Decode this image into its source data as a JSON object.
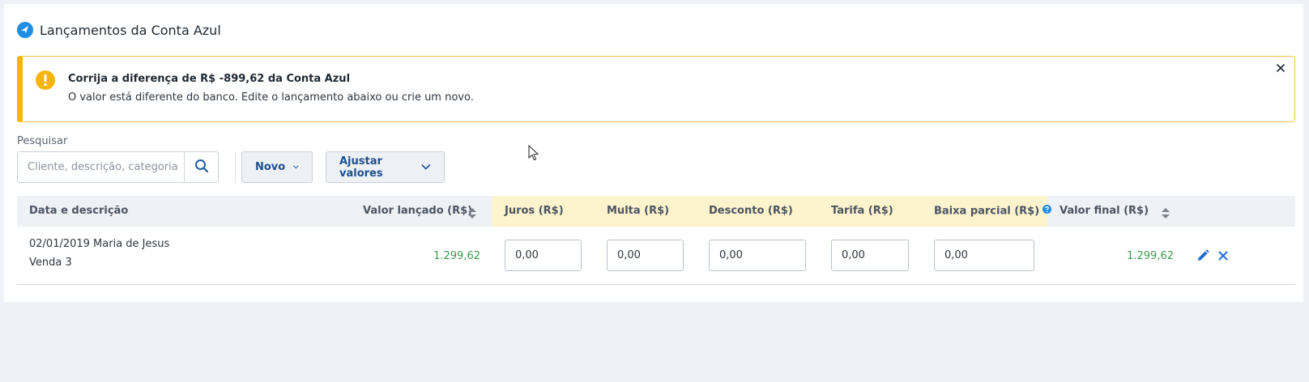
{
  "header": {
    "title": "Lançamentos da Conta Azul"
  },
  "alert": {
    "title": "Corrija a diferença de R$ -899,62 da Conta Azul",
    "message": "O valor está diferente do banco. Edite o lançamento abaixo ou crie um novo."
  },
  "search": {
    "label": "Pesquisar",
    "placeholder": "Cliente, descrição, categoria"
  },
  "toolbar": {
    "new_label": "Novo",
    "adjust_label": "Ajustar valores"
  },
  "table": {
    "columns": {
      "date_desc": "Data e descrição",
      "posted_value": "Valor lançado (R$)",
      "interest": "Juros (R$)",
      "fine": "Multa (R$)",
      "discount": "Desconto (R$)",
      "fee": "Tarifa (R$)",
      "partial": "Baixa parcial (R$)",
      "final_value": "Valor final (R$)"
    },
    "rows": [
      {
        "date_name": "02/01/2019 Maria de Jesus",
        "description": "Venda 3",
        "posted_value": "1.299,62",
        "interest": "0,00",
        "fine": "0,00",
        "discount": "0,00",
        "fee": "0,00",
        "partial": "0,00",
        "final_value": "1.299,62"
      }
    ]
  },
  "colors": {
    "accent": "#1f8ce6",
    "warning": "#f6b60f",
    "money_green": "#3c9a4f",
    "highlight_header": "#fdf3cc"
  },
  "icons": [
    "conta-azul-logo-icon",
    "warning-icon",
    "close-icon",
    "search-icon",
    "chevron-down-icon",
    "sort-icon",
    "help-icon",
    "edit-icon",
    "delete-icon",
    "cursor-icon"
  ]
}
